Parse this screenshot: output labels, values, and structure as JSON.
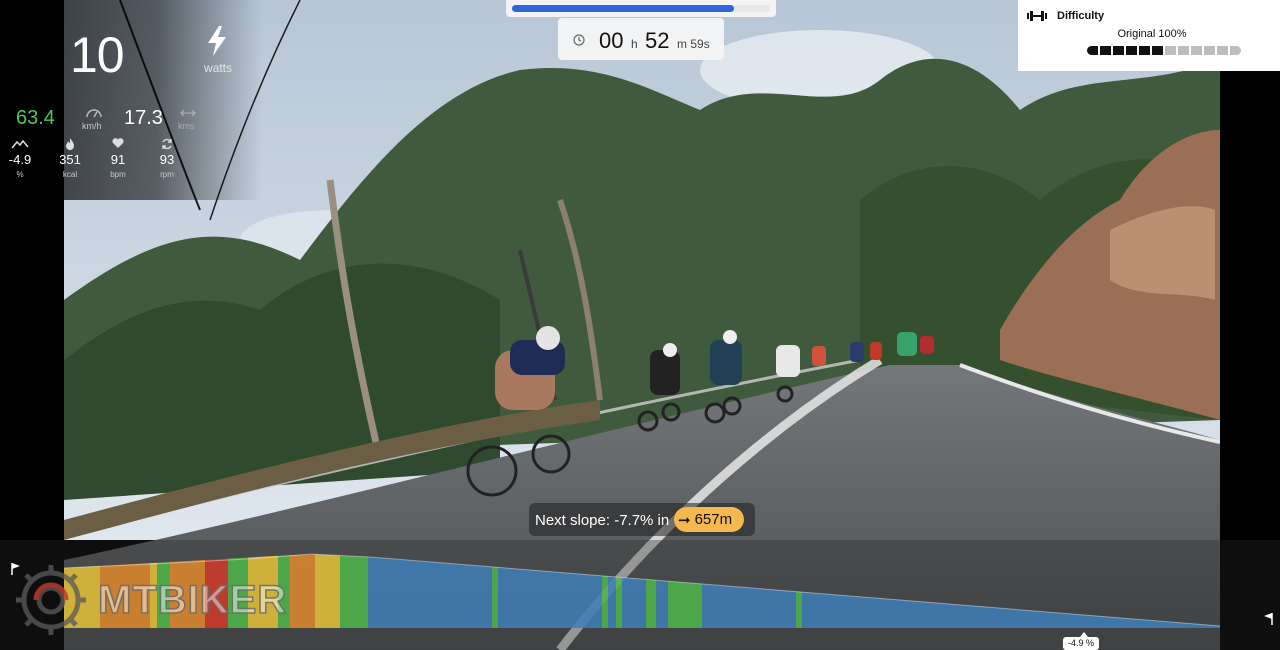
{
  "hud": {
    "power": {
      "value": "10",
      "unit": "watts",
      "icon": "lightning-bolt-icon"
    },
    "speed": {
      "value": "63.4",
      "unit": "km/h",
      "icon": "speedometer-icon",
      "color": "#4cc85a"
    },
    "distance": {
      "value": "17.3",
      "unit": "kms",
      "icon": "arrows-horizontal-icon"
    },
    "metrics": [
      {
        "name": "grade",
        "icon": "mountain-icon",
        "value": "-4.9",
        "unit": "%"
      },
      {
        "name": "calories",
        "icon": "flame-icon",
        "value": "351",
        "unit": "kcal"
      },
      {
        "name": "heart-rate",
        "icon": "heart-icon",
        "value": "91",
        "unit": "bpm"
      },
      {
        "name": "cadence",
        "icon": "cycle-icon",
        "value": "93",
        "unit": "rpm"
      }
    ]
  },
  "timer": {
    "hours": "00",
    "hours_unit": "h",
    "minutes": "52",
    "minutes_unit": "m",
    "seconds": "59s",
    "progress": 0.86,
    "progress_color": "#2f66e0"
  },
  "difficulty": {
    "title": "Difficulty",
    "level_label": "Original 100%",
    "segments_total": 12,
    "segments_active": 6
  },
  "next_slope": {
    "label": "Next slope: -7.7% in",
    "distance": "657m",
    "pill_color": "#f4b94e"
  },
  "elevation_profile": {
    "current_grade": "-4.9 %",
    "colors": {
      "climb_high": "#d43a2a",
      "climb_mid": "#e08a2c",
      "climb_low": "#e6c338",
      "flat": "#4fb84a",
      "descent": "#3f7fb8"
    }
  },
  "watermark": {
    "text": "MTBIKER"
  }
}
